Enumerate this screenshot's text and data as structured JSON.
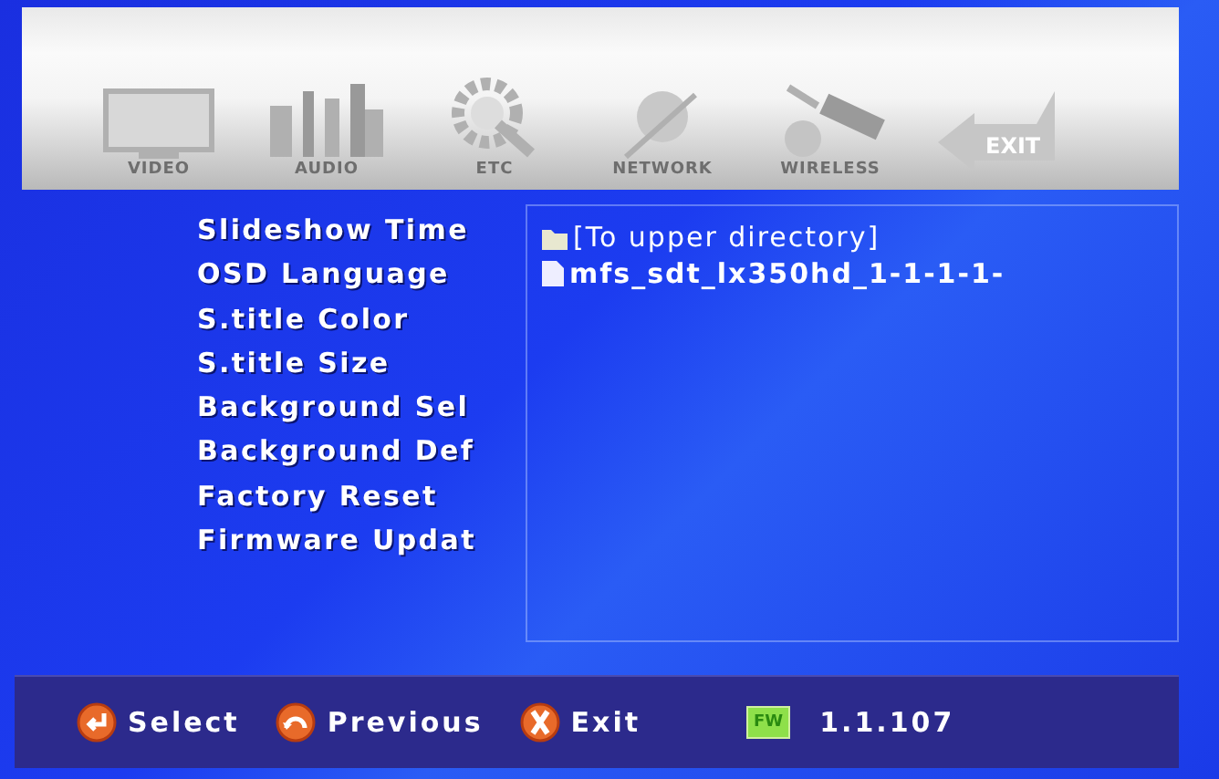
{
  "tabs": [
    {
      "label": "VIDEO",
      "kind": "tv"
    },
    {
      "label": "AUDIO",
      "kind": "speakers"
    },
    {
      "label": "ETC",
      "kind": "gear"
    },
    {
      "label": "NETWORK",
      "kind": "globe"
    },
    {
      "label": "WIRELESS",
      "kind": "satellite"
    },
    {
      "label": "EXIT",
      "kind": "exit"
    }
  ],
  "menu": [
    "Slideshow Time",
    "OSD Language",
    "S.title Color",
    "S.title Size",
    "Background Sel",
    "Background Def",
    "Factory Reset",
    "Firmware Updat"
  ],
  "files": [
    {
      "name": "[To upper directory]",
      "kind": "folder"
    },
    {
      "name": "mfs_sdt_lx350hd_1-1-1-1-",
      "kind": "file"
    }
  ],
  "hints": [
    {
      "label": "Select",
      "kind": "enter"
    },
    {
      "label": "Previous",
      "kind": "back"
    },
    {
      "label": "Exit",
      "kind": "exit"
    }
  ],
  "firmware": {
    "badge": "FW",
    "version": "1.1.107"
  }
}
